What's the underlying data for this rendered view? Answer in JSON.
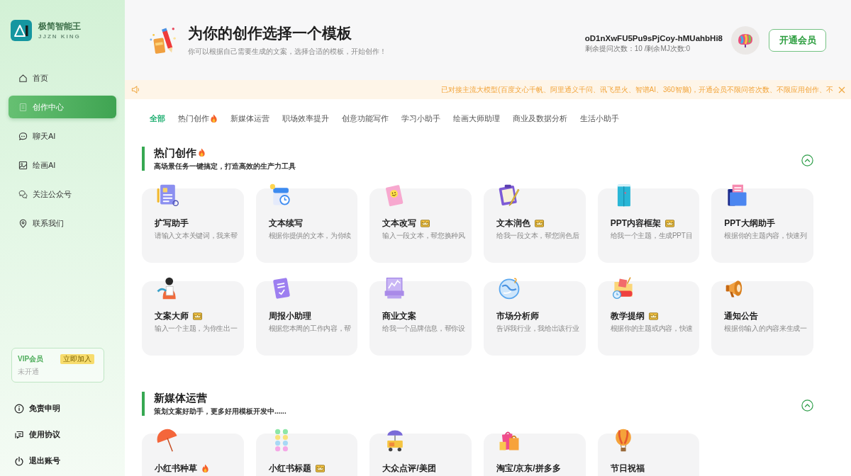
{
  "sidebar": {
    "logo": {
      "name": "极简智能王",
      "subtitle": "JJZN KING"
    },
    "nav": [
      {
        "label": "首页",
        "selected": false
      },
      {
        "label": "创作中心",
        "selected": true
      },
      {
        "label": "聊天AI",
        "selected": false
      },
      {
        "label": "绘画AI",
        "selected": false
      },
      {
        "label": "关注公众号",
        "selected": false
      },
      {
        "label": "联系我们",
        "selected": false
      }
    ],
    "vip_card": {
      "title": "VIP会员",
      "button": "立即加入",
      "status": "未开通"
    },
    "footer_links": [
      "免责申明",
      "使用协议",
      "退出账号"
    ]
  },
  "header": {
    "title": "为你的创作选择一个模板",
    "subtitle": "你可以根据自己需要生成的文案，选择合适的模板，开始创作！",
    "user": {
      "name": "oD1nXwFU5Pu9sPjCoy-hMUahbHi8",
      "quota": "剩余提问次数：10 /剩余MJ次数:0"
    },
    "upgrade_button": "开通会员"
  },
  "notice": {
    "text": "已对接主流大模型(百度文心千帆、阿里通义千问、讯飞星火、智谱AI、360智脑)，开通会员不限问答次数、不限应用创作、不"
  },
  "tabs": [
    {
      "label": "全部",
      "hot": false,
      "selected": true
    },
    {
      "label": "热门创作",
      "hot": true,
      "selected": false
    },
    {
      "label": "新媒体运营",
      "hot": false,
      "selected": false
    },
    {
      "label": "职场效率提升",
      "hot": false,
      "selected": false
    },
    {
      "label": "创意功能写作",
      "hot": false,
      "selected": false
    },
    {
      "label": "学习小助手",
      "hot": false,
      "selected": false
    },
    {
      "label": "绘画大师助理",
      "hot": false,
      "selected": false
    },
    {
      "label": "商业及数据分析",
      "hot": false,
      "selected": false
    },
    {
      "label": "生活小助手",
      "hot": false,
      "selected": false
    }
  ],
  "sections": [
    {
      "title": "热门创作",
      "hot": true,
      "subtitle": "高场景任务一键搞定，打造高效的生产力工具",
      "expanded": true,
      "cards": [
        {
          "title": "扩写助手",
          "hot": false,
          "premium": false,
          "description": "请输入文本关键词，我来帮"
        },
        {
          "title": "文本续写",
          "hot": false,
          "premium": false,
          "description": "根据你提供的文本，为你续"
        },
        {
          "title": "文本改写",
          "hot": false,
          "premium": true,
          "description": "输入一段文本，帮您换种风"
        },
        {
          "title": "文本润色",
          "hot": false,
          "premium": true,
          "description": "给我一段文本，帮您润色后"
        },
        {
          "title": "PPT内容框架",
          "hot": false,
          "premium": true,
          "description": "给我一个主题，生成PPT目"
        },
        {
          "title": "PPT大纲助手",
          "hot": false,
          "premium": false,
          "description": "根据你的主题内容，快速列"
        },
        {
          "title": "文案大师",
          "hot": false,
          "premium": true,
          "description": "输入一个主题，为你生出一"
        },
        {
          "title": "周报小助理",
          "hot": false,
          "premium": false,
          "description": "根据您本周的工作内容，帮"
        },
        {
          "title": "商业文案",
          "hot": false,
          "premium": false,
          "description": "给我一个品牌信息，帮你设"
        },
        {
          "title": "市场分析师",
          "hot": false,
          "premium": false,
          "description": "告诉我行业，我给出该行业"
        },
        {
          "title": "教学提纲",
          "hot": false,
          "premium": true,
          "description": "根据你的主题或内容，快速"
        },
        {
          "title": "通知公告",
          "hot": false,
          "premium": false,
          "description": "根据你输入的内容来生成一"
        }
      ]
    },
    {
      "title": "新媒体运营",
      "hot": false,
      "subtitle": "策划文案好助手，更多好用模板开发中......",
      "expanded": true,
      "cards": [
        {
          "title": "小红书种草",
          "hot": true,
          "premium": false
        },
        {
          "title": "小红书标题",
          "hot": false,
          "premium": true
        },
        {
          "title": "大众点评/美团",
          "hot": false,
          "premium": false
        },
        {
          "title": "淘宝/京东/拼多多",
          "hot": false,
          "premium": false
        },
        {
          "title": "节日祝福",
          "hot": false,
          "premium": false
        }
      ]
    }
  ]
}
